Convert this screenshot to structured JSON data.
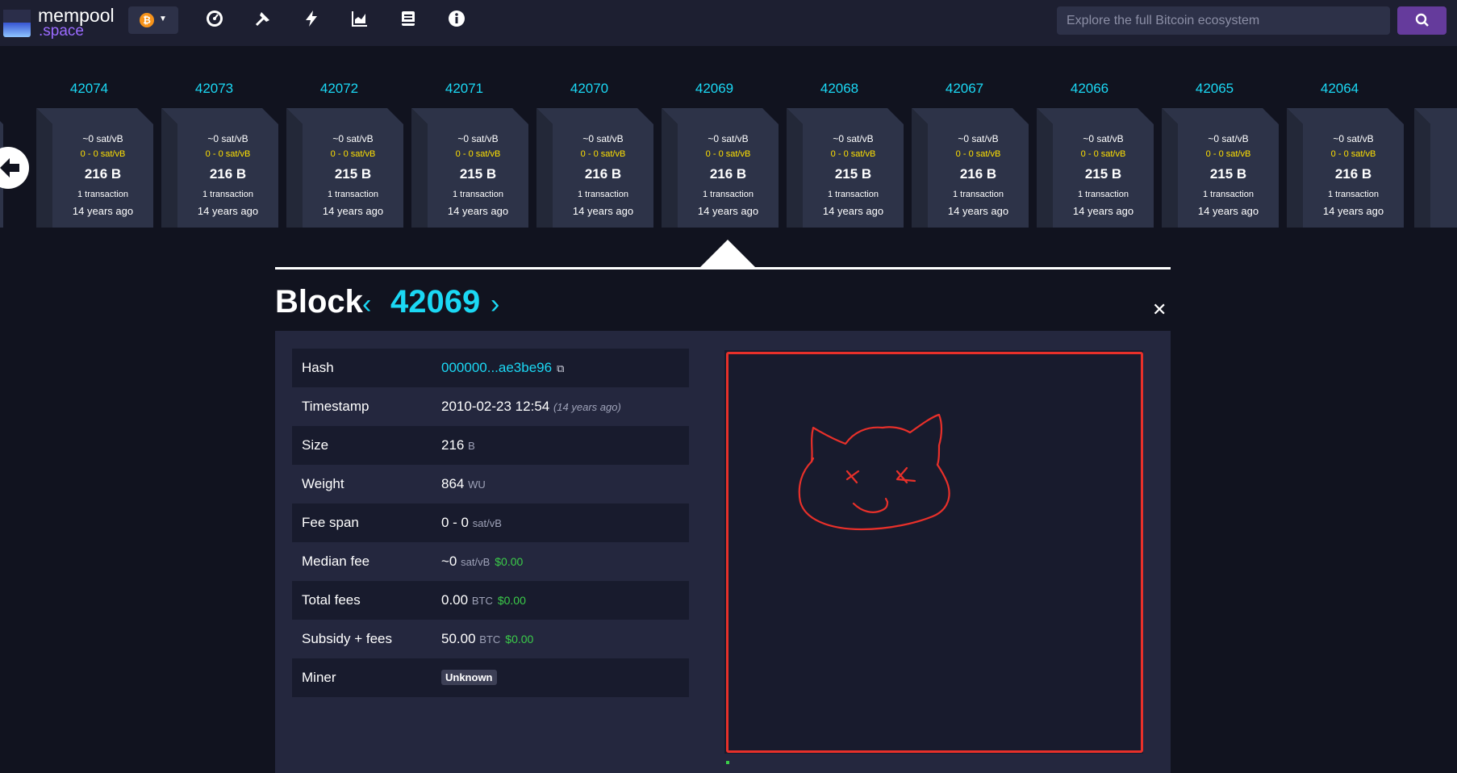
{
  "header": {
    "logo_line1": "mempool",
    "logo_line2": ".space",
    "network_symbol": "₿",
    "nav_icons": [
      "dashboard-icon",
      "mining-icon",
      "lightning-icon",
      "graphs-icon",
      "docs-icon",
      "about-icon"
    ],
    "search_placeholder": "Explore the full Bitcoin ecosystem"
  },
  "blocks": [
    {
      "height": "42074",
      "fee": "~0 sat/vB",
      "range": "0 - 0 sat/vB",
      "size": "216 B",
      "tx": "1 transaction",
      "age": "14 years ago"
    },
    {
      "height": "42073",
      "fee": "~0 sat/vB",
      "range": "0 - 0 sat/vB",
      "size": "216 B",
      "tx": "1 transaction",
      "age": "14 years ago"
    },
    {
      "height": "42072",
      "fee": "~0 sat/vB",
      "range": "0 - 0 sat/vB",
      "size": "215 B",
      "tx": "1 transaction",
      "age": "14 years ago"
    },
    {
      "height": "42071",
      "fee": "~0 sat/vB",
      "range": "0 - 0 sat/vB",
      "size": "215 B",
      "tx": "1 transaction",
      "age": "14 years ago"
    },
    {
      "height": "42070",
      "fee": "~0 sat/vB",
      "range": "0 - 0 sat/vB",
      "size": "216 B",
      "tx": "1 transaction",
      "age": "14 years ago"
    },
    {
      "height": "42069",
      "fee": "~0 sat/vB",
      "range": "0 - 0 sat/vB",
      "size": "216 B",
      "tx": "1 transaction",
      "age": "14 years ago"
    },
    {
      "height": "42068",
      "fee": "~0 sat/vB",
      "range": "0 - 0 sat/vB",
      "size": "215 B",
      "tx": "1 transaction",
      "age": "14 years ago"
    },
    {
      "height": "42067",
      "fee": "~0 sat/vB",
      "range": "0 - 0 sat/vB",
      "size": "216 B",
      "tx": "1 transaction",
      "age": "14 years ago"
    },
    {
      "height": "42066",
      "fee": "~0 sat/vB",
      "range": "0 - 0 sat/vB",
      "size": "215 B",
      "tx": "1 transaction",
      "age": "14 years ago"
    },
    {
      "height": "42065",
      "fee": "~0 sat/vB",
      "range": "0 - 0 sat/vB",
      "size": "215 B",
      "tx": "1 transaction",
      "age": "14 years ago"
    },
    {
      "height": "42064",
      "fee": "~0 sat/vB",
      "range": "0 - 0 sat/vB",
      "size": "216 B",
      "tx": "1 transaction",
      "age": "14 years ago"
    }
  ],
  "block_detail": {
    "title": "Block",
    "number": "42069",
    "rows": {
      "hash": {
        "label": "Hash",
        "value": "000000...ae3be96"
      },
      "timestamp": {
        "label": "Timestamp",
        "value": "2010-02-23 12:54",
        "relative": "(14 years ago)"
      },
      "size": {
        "label": "Size",
        "value": "216",
        "unit": "B"
      },
      "weight": {
        "label": "Weight",
        "value": "864",
        "unit": "WU"
      },
      "fee_span": {
        "label": "Fee span",
        "value": "0 - 0",
        "unit": "sat/vB"
      },
      "median_fee": {
        "label": "Median fee",
        "value": "~0",
        "unit": "sat/vB",
        "usd": "$0.00"
      },
      "total_fees": {
        "label": "Total fees",
        "value": "0.00",
        "unit": "BTC",
        "usd": "$0.00"
      },
      "subsidy_fees": {
        "label": "Subsidy + fees",
        "value": "50.00",
        "unit": "BTC",
        "usd": "$0.00"
      },
      "miner": {
        "label": "Miner",
        "value": "Unknown"
      }
    }
  },
  "colors": {
    "accent": "#1bd8f4",
    "fee_range": "#ffe000",
    "usd": "#3bcc49",
    "doodle": "#e8302a",
    "search_button": "#653b9c"
  }
}
